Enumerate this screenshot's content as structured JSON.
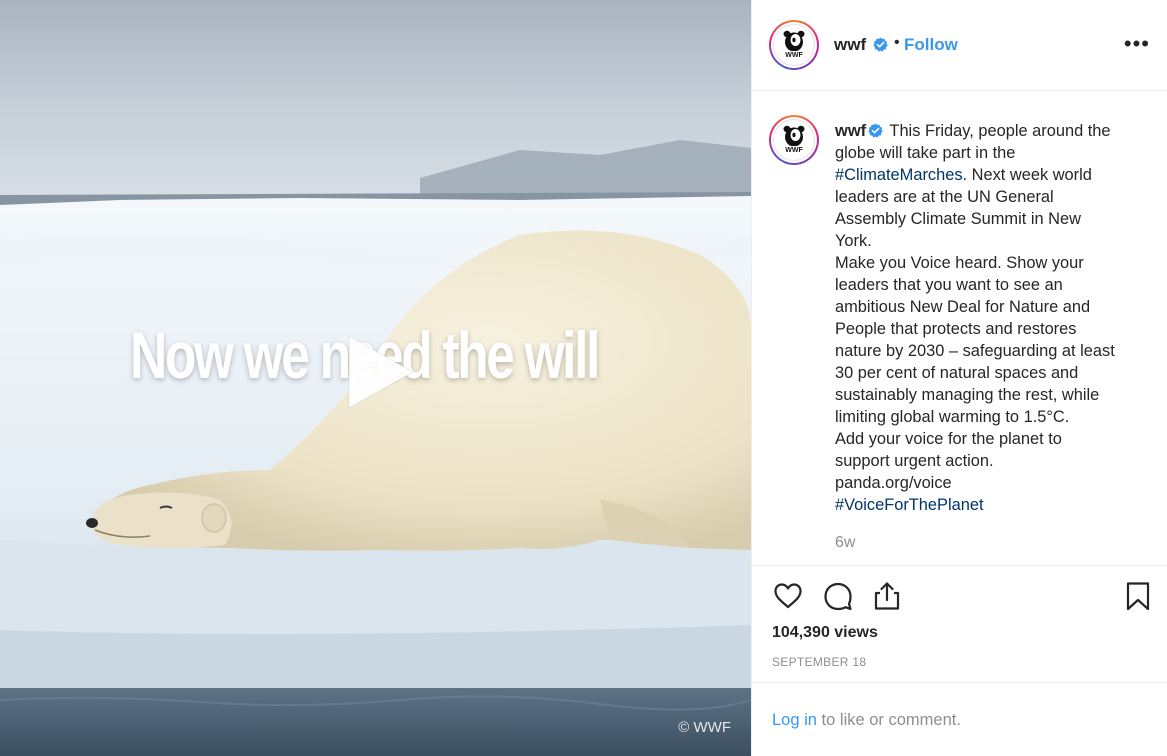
{
  "media": {
    "overlay_text": "Now we need the will",
    "watermark": "© WWF",
    "play_icon": "play-icon"
  },
  "post": {
    "username": "wwf",
    "verified_icon": "verified-badge-icon",
    "separator": "•",
    "follow_label": "Follow",
    "more_label": "•••",
    "caption_lines": [
      "This Friday, people around the",
      "globe will take part in the",
      "#ClimateMarches",
      ". Next week world",
      "leaders are at the UN General",
      "Assembly Climate Summit in New",
      "York.",
      "Make you Voice heard. Show your",
      "leaders that you want to see an",
      "ambitious New Deal for Nature and",
      "People that protects and restores",
      "nature by 2030 – safeguarding at least",
      "30 per cent of natural spaces and",
      "sustainably managing the rest, while",
      "limiting global warming to 1.5°C.",
      "Add your voice for the planet to",
      "support urgent action.",
      "panda.org/voice",
      "#VoiceForThePlanet"
    ],
    "timestamp": "6w",
    "views": "104,390 views",
    "date": "SEPTEMBER 18"
  },
  "actions": {
    "like_icon": "heart-icon",
    "comment_icon": "comment-icon",
    "share_icon": "share-icon",
    "save_icon": "bookmark-icon"
  },
  "login": {
    "link_label": "Log in",
    "rest_label": " to like or comment."
  },
  "colors": {
    "accent": "#3897f0",
    "hashtag": "#003569",
    "muted": "#8e8e8e",
    "text": "#262626"
  }
}
